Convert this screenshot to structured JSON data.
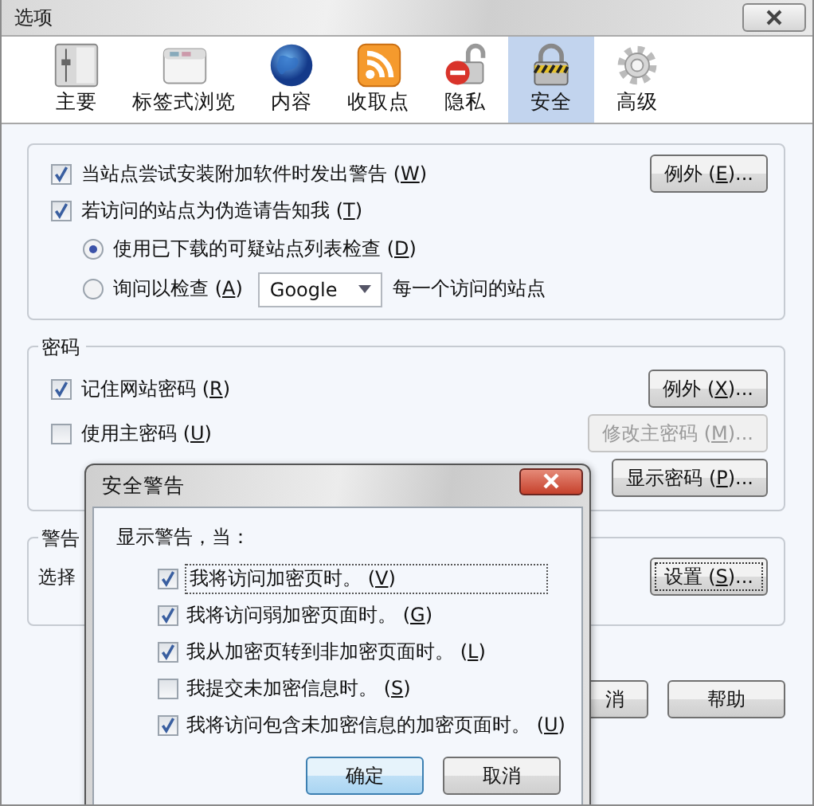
{
  "window": {
    "title": "选项"
  },
  "toolbar": [
    {
      "label": "主要",
      "kind": "general",
      "selected": false
    },
    {
      "label": "标签式浏览",
      "kind": "tabs",
      "selected": false
    },
    {
      "label": "内容",
      "kind": "content",
      "selected": false
    },
    {
      "label": "收取点",
      "kind": "feeds",
      "selected": false
    },
    {
      "label": "隐私",
      "kind": "privacy",
      "selected": false
    },
    {
      "label": "安全",
      "kind": "security",
      "selected": true
    },
    {
      "label": "高级",
      "kind": "advanced",
      "selected": false
    }
  ],
  "security": {
    "warn_addons": {
      "text": "当站点尝试安装附加软件时发出警告 (W)",
      "checked": true
    },
    "addons_exceptions": {
      "text": "例外 (E)..."
    },
    "forgery": {
      "text": "若访问的站点为伪造请告知我 (T)",
      "checked": true
    },
    "forgery_options": [
      {
        "text": "使用已下载的可疑站点列表检查 (D)",
        "selected": true
      },
      {
        "text": "询问以检查 (A)",
        "selected": false
      }
    ],
    "provider": {
      "value": "Google"
    },
    "provider_suffix": "每一个访问的站点"
  },
  "passwords": {
    "legend": "密码",
    "remember": {
      "text": "记住网站密码 (R)",
      "checked": true
    },
    "remember_exceptions": {
      "text": "例外 (X)..."
    },
    "master": {
      "text": "使用主密码 (U)",
      "checked": false
    },
    "change_master": {
      "text": "修改主密码 (M)...",
      "disabled": true
    },
    "show": {
      "text": "显示密码 (P)..."
    }
  },
  "warnings": {
    "legend": "警告",
    "text": "选择",
    "settings": {
      "text": "设置 (S)..."
    }
  },
  "footer_buttons": [
    {
      "label": "消"
    },
    {
      "label": "帮助"
    }
  ],
  "dialog": {
    "title": "安全警告",
    "prompt": "显示警告，当：",
    "options": [
      {
        "text": "我将访问加密页时。 (V)",
        "checked": true,
        "focused": true
      },
      {
        "text": "我将访问弱加密页面时。 (G)",
        "checked": true,
        "focused": false
      },
      {
        "text": "我从加密页转到非加密页面时。 (L)",
        "checked": true,
        "focused": false
      },
      {
        "text": "我提交未加密信息时。 (S)",
        "checked": false,
        "focused": false
      },
      {
        "text": "我将访问包含未加密信息的加密页面时。 (U)",
        "checked": true,
        "focused": false
      }
    ],
    "buttons": [
      {
        "label": "确定",
        "default": true
      },
      {
        "label": "取消",
        "default": false
      }
    ]
  }
}
